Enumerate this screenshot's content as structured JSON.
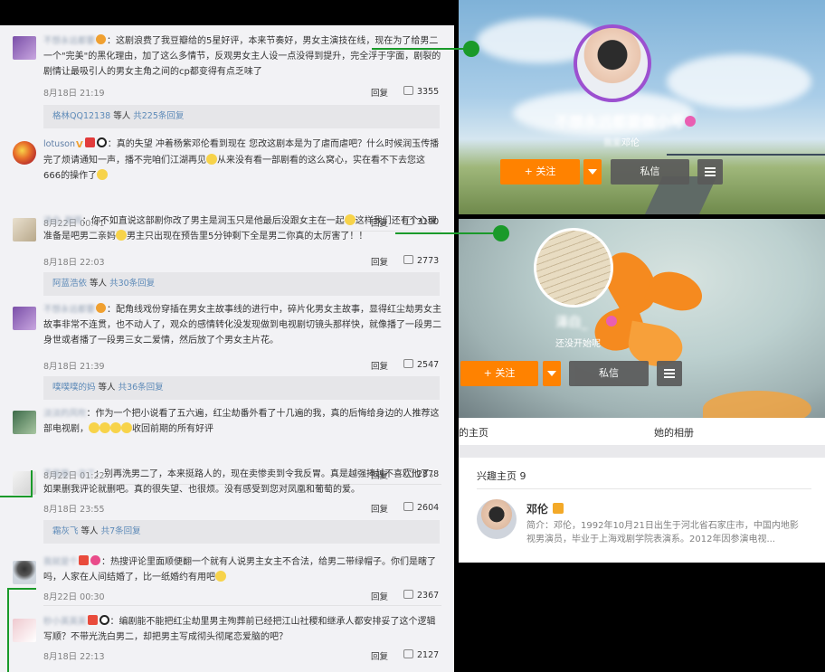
{
  "comments": [
    {
      "user": "不想永远都要",
      "text_before": "：这剧浪费了我豆瓣给的5星好评，本来节奏好，男女主演技在线，现在为了给男二一个\"完美\"的黑化理由，加了这么多情节，反观男女主人设一点没得到提升，完全浮于字面，剧裂的剧情让最吸引人的男女主角之间的cp都变得有点乏味了",
      "text_after": "",
      "time": "8月18日 21:19",
      "reply": "回复",
      "likes": "3355",
      "sub": {
        "users": "格林QQ12138",
        "rest": " 等人 ",
        "count": "共225条回复"
      }
    },
    {
      "user": "lotuson",
      "text_before": "：真的失望 冲着杨紫邓伦看到现在 您改这剧本是为了虐而虐吧？什么时候润玉传播完了烦请通知一声，播不完咱们江湖再见",
      "text_after": "从来没有看一部剧看的这么窝心，实在看不下去您这666的操作了",
      "time": "8月22日 00:41",
      "reply": "回复",
      "likes": "3190"
    },
    {
      "user": "泽白_剧哥",
      "text_before": "：你不如直说这部剧你改了男主是润玉只是他最后没跟女主在一起",
      "text_mid": "这样我们还有个心理准备是吧男二亲妈",
      "text_after": "男主只出现在预告里5分钟剩下全是男二你真的太厉害了！！",
      "time": "8月18日 22:03",
      "reply": "回复",
      "likes": "2773",
      "sub": {
        "users": "阿蓝浩依",
        "rest": " 等人 ",
        "count": "共30条回复"
      }
    },
    {
      "user": "不想永远都要",
      "text_before": "：配角线戏份穿插在男女主故事线的进行中，碎片化男女主故事，显得红尘劫男女主故事非常不连贯，也不动人了，观众的感情转化没发现做到电视剧切镜头那样快，就像播了一段男二身世或者播了一段男三女二爱情，然后放了个男女主片花。",
      "text_after": "",
      "time": "8月18日 21:39",
      "reply": "回复",
      "likes": "2547",
      "sub": {
        "users": "噗噗噗的妈",
        "rest": " 等人 ",
        "count": "共36条回复"
      }
    },
    {
      "user": "淡淡的风吹",
      "text_before": "：作为一个把小说看了五六遍，红尘劫番外看了十几遍的我，真的后悔给身边的人推荐这部电视剧，",
      "text_after": "收回前期的所有好评",
      "time": "8月22日 01:22",
      "reply": "回复",
      "likes": "2878"
    },
    {
      "user": "不是第一次了",
      "text_before": "：别再洗男二了，本来挺路人的，现在卖惨卖到令我反胃。真是越强捧越不喜欢他了。如果删我评论就删吧。真的很失望、也很烦。没有感受到您对凤凰和葡萄的爱。",
      "text_after": "",
      "time": "8月18日 23:55",
      "reply": "回复",
      "likes": "2604",
      "sub": {
        "users": "霜灰飞",
        "rest": " 等人 ",
        "count": "共7条回复"
      }
    },
    {
      "user": "我就是个",
      "text_before": "：热搜评论里面顺便翻一个就有人说男主女主不合法，给男二带绿帽子。你们是瞎了吗，人家在人间结婚了，比一纸婚约有用吧",
      "text_after": "",
      "time": "8月22日 00:30",
      "reply": "回复",
      "likes": "2367"
    },
    {
      "user": "秒小英英英",
      "text_before": "：编剧能不能把红尘劫里男主殉葬前已经把江山社稷和继承人都安排妥了这个逻辑写顺？不带光洗白男二，却把男主写成彻头彻尾恋爱脑的吧？",
      "text_after": "",
      "time": "8月18日 22:13",
      "reply": "回复",
      "likes": "2127"
    }
  ],
  "profile1": {
    "name": "不想永远都要做小号",
    "desc_prefix": "",
    "desc_blur": "我爱",
    "desc_suffix": "邓伦",
    "follow": "+ 关注",
    "message": "私信"
  },
  "profile2": {
    "name": "泽白_",
    "desc": "还没开始呢",
    "follow": "+ 关注",
    "message": "私信",
    "tab_home": "的主页",
    "tab_album": "她的相册"
  },
  "interest": {
    "header": "兴趣主页 9",
    "name": "邓伦",
    "desc_label": "简介",
    "desc": "邓伦，1992年10月21日出生于河北省石家庄市，中国内地影视男演员，毕业于上海戏剧学院表演系。2012年因参演电视..."
  },
  "colors": {
    "accent": "#ff8200",
    "connector": "#1a9a2a",
    "link": "#5d8ab8"
  }
}
